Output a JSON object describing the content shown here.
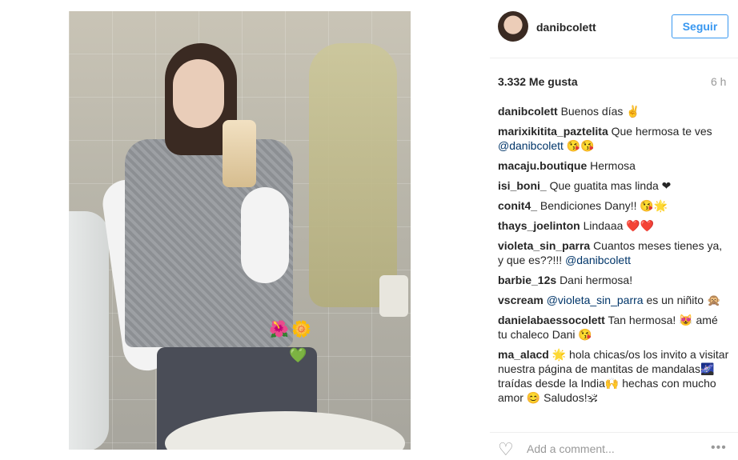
{
  "post": {
    "username": "danibcolett",
    "follow_label": "Seguir",
    "likes": "3.332 Me gusta",
    "time": "6 h"
  },
  "comments": [
    {
      "user": "danibcolett",
      "text": "Buenos días ✌️"
    },
    {
      "user": "marixikitita_paztelita",
      "text": "Que hermosa te ves",
      "mention": "@danibcolett",
      "tail": " 😘😘"
    },
    {
      "user": "macaju.boutique",
      "text": "Hermosa"
    },
    {
      "user": "isi_boni_",
      "text": "Que guatita mas linda ❤"
    },
    {
      "user": "conit4_",
      "text": "Bendiciones Dany!! 😘🌟"
    },
    {
      "user": "thays_joelinton",
      "text": "Lindaaa ❤️❤️"
    },
    {
      "user": "violeta_sin_parra",
      "text": "Cuantos meses tienes ya, y que es??!!!",
      "mention": "@danibcolett"
    },
    {
      "user": "barbie_12s",
      "text": "Dani hermosa!"
    },
    {
      "user": "vscream",
      "text": "",
      "mention": "@violeta_sin_parra",
      "tail": " es un niñito 🙊"
    },
    {
      "user": "danielabaessocolett",
      "text": "Tan hermosa! 😻 amé tu chaleco Dani 😘"
    },
    {
      "user": "ma_alacd",
      "text": "🌟 hola chicas/os los invito a visitar nuestra página de mantitas de mandalas🌌 traídas desde la India🙌 hechas con mucho amor 😊 Saludos!🕉"
    }
  ],
  "footer": {
    "add_comment": "Add a comment..."
  },
  "colors": {
    "accent": "#3897f0",
    "mention": "#003569"
  }
}
